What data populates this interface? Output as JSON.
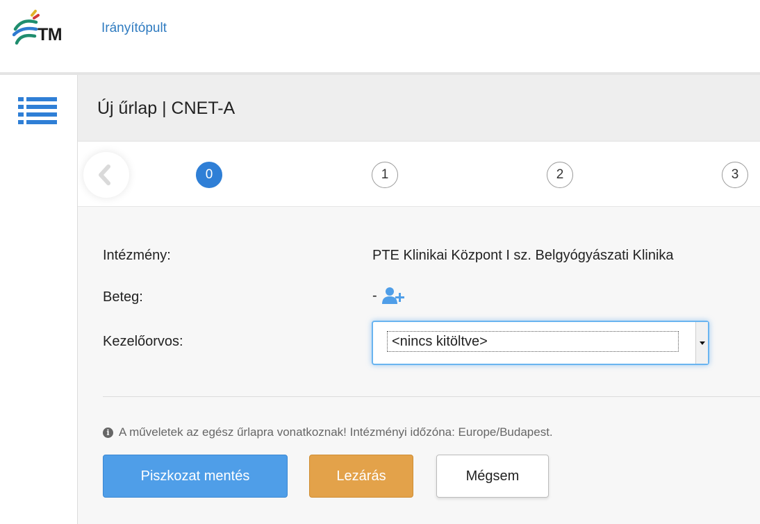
{
  "brand": {
    "logo_text": "TM"
  },
  "nav": {
    "dashboard_link": "Irányítópult"
  },
  "page": {
    "title": "Új űrlap | CNET-A"
  },
  "stepper": {
    "steps": [
      {
        "label": "0",
        "active": true
      },
      {
        "label": "1",
        "active": false
      },
      {
        "label": "2",
        "active": false
      },
      {
        "label": "3",
        "active": false
      }
    ]
  },
  "form": {
    "institution": {
      "label": "Intézmény:",
      "value": "PTE Klinikai Központ I sz. Belgyógyászati Klinika"
    },
    "patient": {
      "label": "Beteg:",
      "value": "-"
    },
    "physician": {
      "label": "Kezelőorvos:",
      "selected": "<nincs kitöltve>"
    }
  },
  "info": {
    "text": "A műveletek az egész űrlapra vonatkoznak! Intézményi időzóna: Europe/Budapest."
  },
  "buttons": {
    "save_draft": "Piszkozat mentés",
    "close": "Lezárás",
    "cancel": "Mégsem"
  },
  "colors": {
    "accent_blue": "#2f7fd6",
    "primary_button": "#4f9ee8",
    "warning_button": "#e3a24a",
    "link": "#2f7bc0"
  }
}
